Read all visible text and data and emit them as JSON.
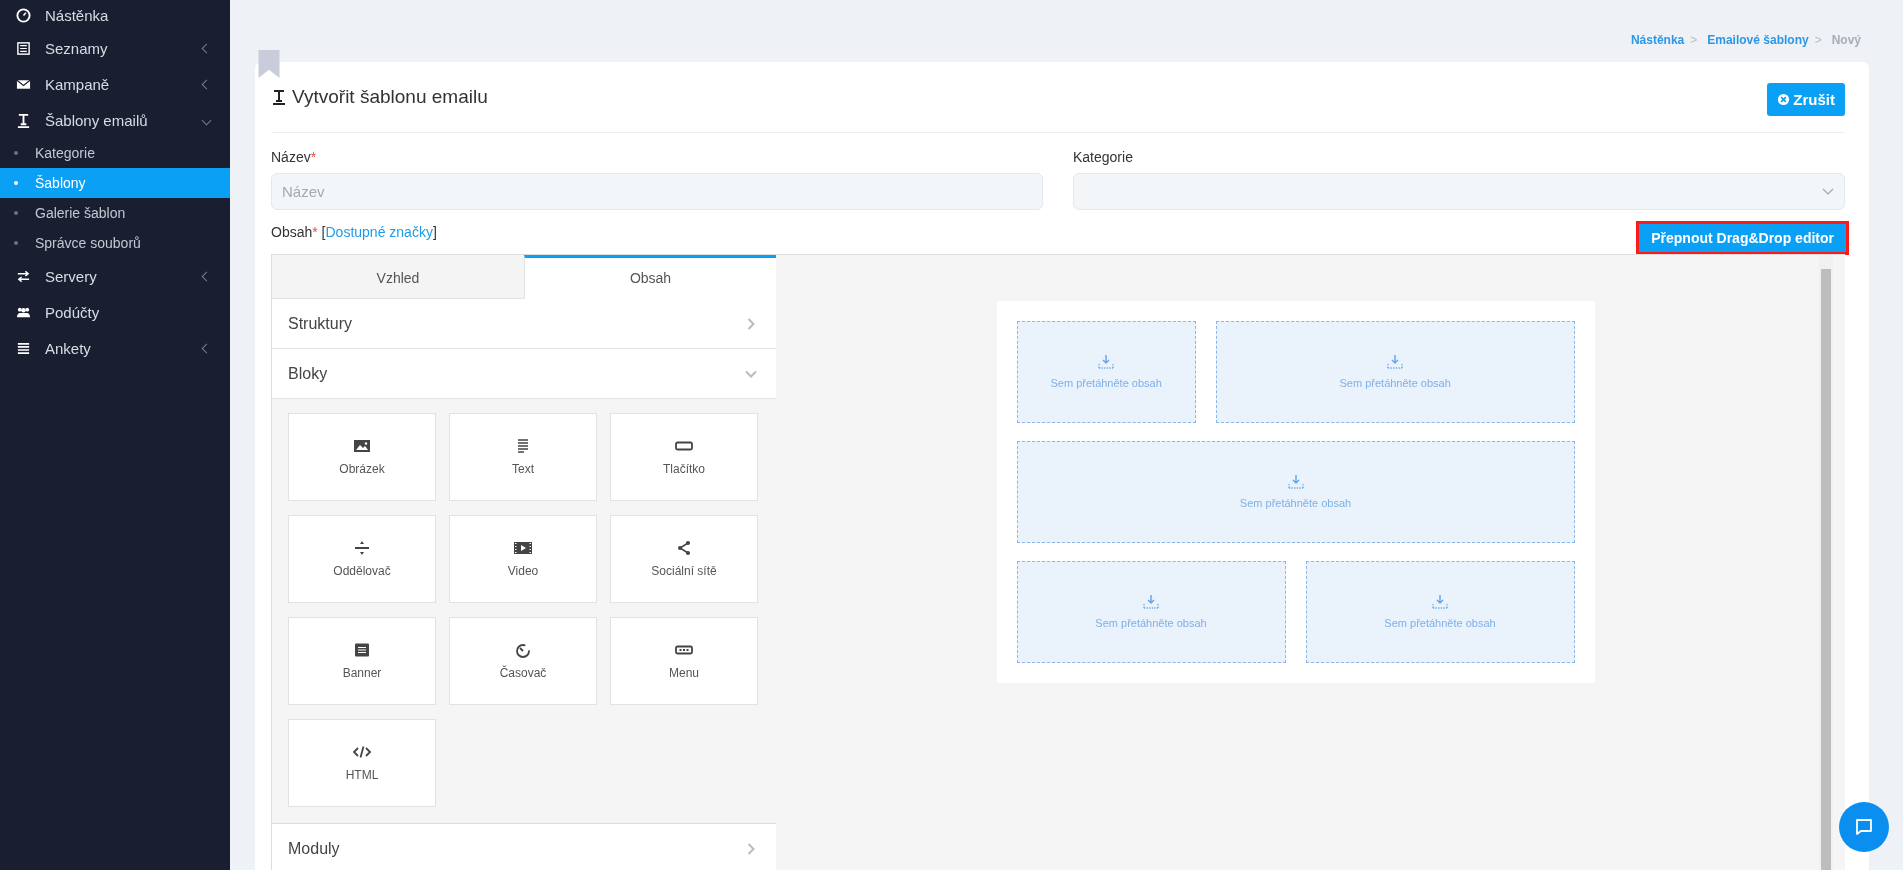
{
  "sidebar": {
    "items": [
      {
        "label": "Nástěnka"
      },
      {
        "label": "Seznamy",
        "expanded": false
      },
      {
        "label": "Kampaně",
        "expanded": false
      },
      {
        "label": "Šablony emailů",
        "expanded": true,
        "children": [
          {
            "label": "Kategorie",
            "selected": false
          },
          {
            "label": "Šablony",
            "selected": true
          },
          {
            "label": "Galerie šablon",
            "selected": false
          },
          {
            "label": "Správce souborů",
            "selected": false
          }
        ]
      },
      {
        "label": "Servery",
        "expanded": false
      },
      {
        "label": "Podúčty"
      },
      {
        "label": "Ankety",
        "expanded": false
      }
    ]
  },
  "breadcrumb": [
    {
      "label": "Nástěnka",
      "separator": ">",
      "current": false
    },
    {
      "label": "Emailové šablony",
      "separator": ">",
      "current": false
    },
    {
      "label": "Nový",
      "current": true
    }
  ],
  "page": {
    "title": "Vytvořit šablonu emailu",
    "cancel_button": "Zrušit"
  },
  "fields": [
    {
      "label": "Název",
      "required_mark": "*",
      "placeholder": "Název",
      "kind": "text"
    },
    {
      "label": "Kategorie",
      "kind": "select"
    }
  ],
  "content_label": {
    "label": "Obsah",
    "required_mark": "*",
    "bracket_open": "[",
    "link": "Dostupné značky",
    "bracket_close": "]"
  },
  "switch_button": "Přepnout Drag&Drop editor",
  "editor": {
    "tabs": [
      {
        "label": "Vzhled",
        "selected": false
      },
      {
        "label": "Obsah",
        "selected": true
      }
    ],
    "sections": [
      {
        "title": "Struktury",
        "expanded": false
      },
      {
        "title": "Bloky",
        "expanded": true,
        "blocks": [
          "Obrázek",
          "Text",
          "Tlačítko",
          "Oddělovač",
          "Video",
          "Sociální sítě",
          "Banner",
          "Časovač",
          "Menu",
          "HTML"
        ]
      },
      {
        "title": "Moduly",
        "expanded": false
      }
    ],
    "canvas_rows": [
      [
        "Sem přetáhněte obsah",
        "Sem přetáhněte obsah"
      ],
      [
        "Sem přetáhněte obsah"
      ],
      [
        "Sem přetáhněte obsah",
        "Sem přetáhněte obsah"
      ]
    ]
  }
}
